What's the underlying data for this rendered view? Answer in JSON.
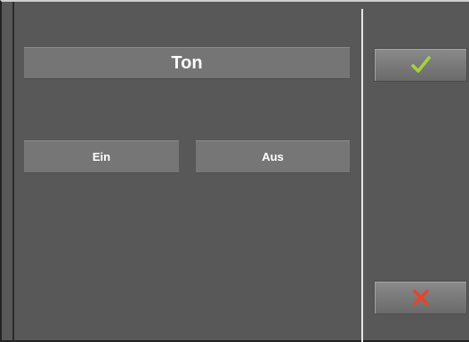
{
  "dialog": {
    "title": "Ton",
    "options": [
      {
        "label": "Ein"
      },
      {
        "label": "Aus"
      }
    ]
  },
  "actions": {
    "confirm_icon": "check-icon",
    "cancel_icon": "close-icon"
  },
  "colors": {
    "background": "#585858",
    "button": "#767676",
    "confirm": "#a6d13c",
    "cancel": "#e8442a"
  }
}
